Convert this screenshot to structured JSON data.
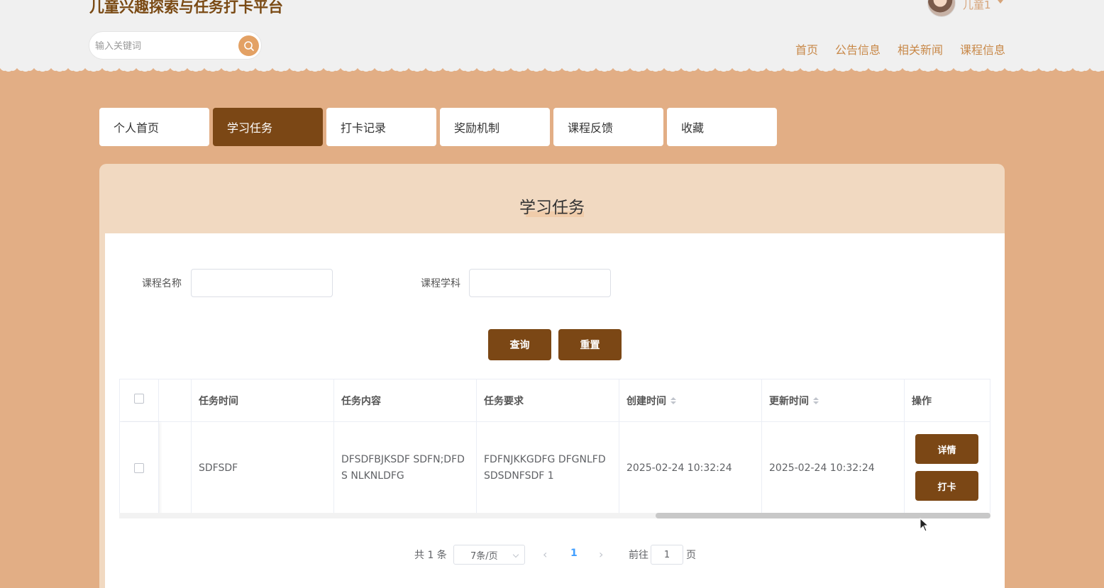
{
  "site": {
    "title": "儿童兴趣探索与任务打卡平台"
  },
  "search": {
    "placeholder": "输入关键词",
    "icon": "search-icon"
  },
  "user": {
    "name": "儿童1"
  },
  "nav": {
    "items": [
      "首页",
      "公告信息",
      "相关新闻",
      "课程信息"
    ]
  },
  "tabs": [
    {
      "label": "个人首页",
      "active": false
    },
    {
      "label": "学习任务",
      "active": true
    },
    {
      "label": "打卡记录",
      "active": false
    },
    {
      "label": "奖励机制",
      "active": false
    },
    {
      "label": "课程反馈",
      "active": false
    },
    {
      "label": "收藏",
      "active": false
    }
  ],
  "panel": {
    "title": "学习任务"
  },
  "filters": {
    "course_name_label": "课程名称",
    "course_name_value": "",
    "course_subject_label": "课程学科",
    "course_subject_value": ""
  },
  "actions": {
    "query_label": "查询",
    "reset_label": "重置"
  },
  "table": {
    "headers": [
      "任务时间",
      "任务内容",
      "任务要求",
      "创建时间",
      "更新时间",
      "操作"
    ],
    "rows": [
      {
        "task_time": "SDFSDF",
        "task_content": "DFSDFBJKSDF SDFN;DFDS NLKNLDFG",
        "task_requirement": "FDFNJKKGDFG DFGNLFD SDSDNFSDF 1",
        "created_at": "2025-02-24 10:32:24",
        "updated_at": "2025-02-24 10:32:24",
        "detail_label": "详情",
        "checkin_label": "打卡"
      }
    ]
  },
  "pagination": {
    "total_text": "共 1 条",
    "page_size": "7条/页",
    "current_page": "1",
    "goto_label": "前往",
    "goto_value": "1",
    "unit_label": "页"
  },
  "colors": {
    "accent": "#7b4715",
    "background": "#e2ae85",
    "header_bg": "#f0f0f0",
    "panel_bg": "#f1d9c1"
  }
}
